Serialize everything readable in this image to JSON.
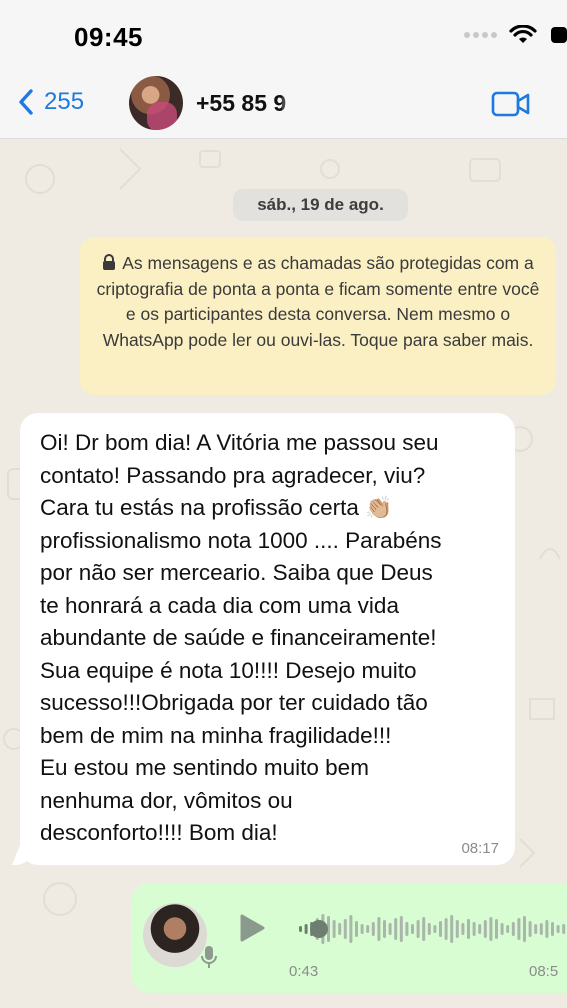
{
  "status": {
    "time": "09:45"
  },
  "header": {
    "back_count": "255",
    "contact_name": "+55 85 9"
  },
  "chat": {
    "date": "sáb., 19 de ago.",
    "encryption_notice": "As mensagens e as chamadas são protegidas com a criptografia de ponta a ponta e ficam somente entre você e os participantes desta conversa. Nem mesmo o WhatsApp pode ler ou ouvi-las. Toque para saber mais.",
    "incoming_message": {
      "text_before_emoji": "Oi! Dr bom dia! A Vitória me passou seu\ncontato! Passando pra agradecer, viu?\nCara tu estás na profissão certa ",
      "emoji": "👏🏼",
      "text_after_emoji": "\nprofissionalismo nota 1000 .... Parabéns\npor não ser merceario. Saiba que Deus\nte honrará a cada dia com uma vida\nabundante de saúde e financeiramente!\nSua equipe é nota 10!!!! Desejo muito\nsucesso!!!Obrigada por ter cuidado tão\nbem de mim na minha fragilidade!!!\nEu estou me sentindo muito bem\nnenhuma dor, vômitos ou\ndesconforto!!!! Bom dia!",
      "time": "08:17"
    },
    "voice_message": {
      "duration": "0:43",
      "time": "08:5",
      "progress": 0.02
    }
  },
  "colors": {
    "accent": "#1f7ae0",
    "chat_bg": "#efeae2",
    "encryption_bg": "#fbf0c4",
    "outgoing_bg": "#d9fdd3"
  },
  "icons": [
    "back-chevron-icon",
    "video-call-icon",
    "lock-icon",
    "play-icon",
    "mic-icon",
    "wifi-icon",
    "battery-icon"
  ]
}
